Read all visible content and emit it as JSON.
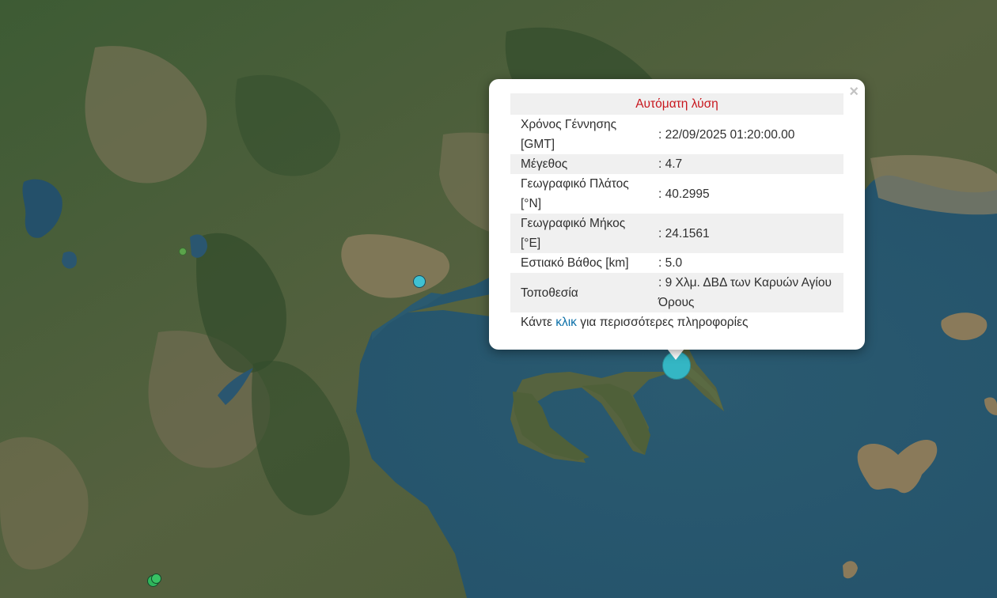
{
  "popup": {
    "title": "Αυτόματη λύση",
    "close_label": "×",
    "rows": [
      {
        "label": "Χρόνος Γέννησης [GMT]",
        "value": ": 22/09/2025 01:20:00.00"
      },
      {
        "label": "Μέγεθος",
        "value": ": 4.7"
      },
      {
        "label": "Γεωγραφικό Πλάτος [°N]",
        "value": ": 40.2995"
      },
      {
        "label": "Γεωγραφικό Μήκος [°E]",
        "value": ": 24.1561"
      },
      {
        "label": "Εστιακό Βάθος [km]",
        "value": ": 5.0"
      },
      {
        "label": "Τοποθεσία",
        "value": ": 9 Χλμ. ΔΒΔ των Καρυών Αγίου Όρους"
      }
    ],
    "more_prefix": "Κάντε",
    "more_link": "κλικ",
    "more_suffix": "για περισσότερες πληροφορίες"
  },
  "colors": {
    "sea": "#2b5e73",
    "land_green": "#3f5c35",
    "land_tan": "#8a7c5c",
    "title_red": "#c8161d",
    "link": "#0a6fa8",
    "marker_main": "#34b6c4"
  },
  "markers": [
    {
      "name": "epicenter-marker",
      "color": "#34b6c4"
    },
    {
      "name": "thessaloniki-marker",
      "color": "#3fc1d3"
    },
    {
      "name": "southwest-marker",
      "color": "#2fb65c"
    }
  ]
}
